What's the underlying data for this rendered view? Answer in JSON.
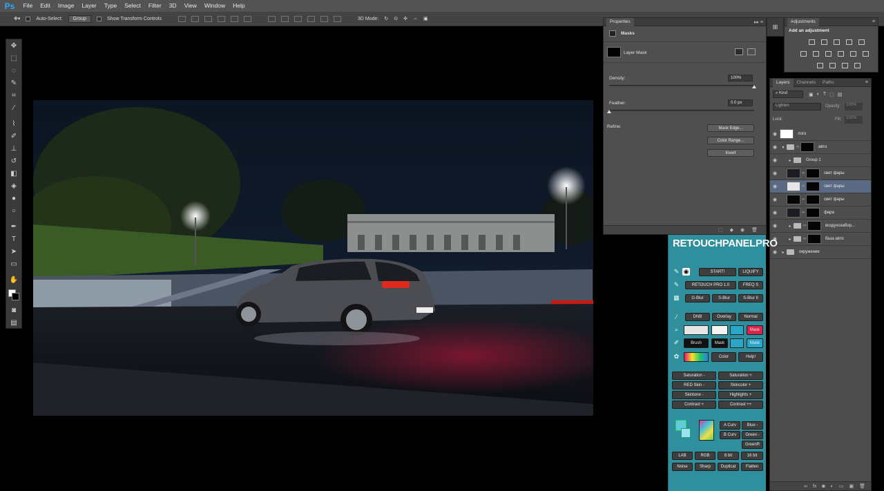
{
  "app": {
    "logo": "Ps"
  },
  "menu": [
    "File",
    "Edit",
    "Image",
    "Layer",
    "Type",
    "Select",
    "Filter",
    "3D",
    "View",
    "Window",
    "Help"
  ],
  "options_bar": {
    "auto_select_label": "Auto-Select:",
    "auto_select_value": "Group",
    "show_transform_label": "Show Transform Controls",
    "mode_3d_label": "3D Mode:"
  },
  "properties": {
    "tab": "Properties",
    "section": "Masks",
    "mask_type": "Layer Mask",
    "density_label": "Density:",
    "density_value": "100%",
    "density_fraction": 1.0,
    "feather_label": "Feather:",
    "feather_value": "0.0 px",
    "feather_fraction": 0.0,
    "refine_label": "Refine:",
    "buttons": [
      "Mask Edge...",
      "Color Range...",
      "Invert"
    ]
  },
  "adjustments": {
    "tab": "Adjustments",
    "title": "Add an adjustment"
  },
  "layers_panel": {
    "tabs": [
      "Layers",
      "Channels",
      "Paths"
    ],
    "filter_kind": "Kind",
    "blend_mode": "Lighten",
    "opacity_label": "Opacity:",
    "opacity_value": "100%",
    "lock_label": "Lock:",
    "fill_label": "Fill:",
    "fill_value": "100%",
    "layers": [
      {
        "name": "лого",
        "thumb": "white",
        "has_mask": false,
        "indent": 0,
        "type": "layer"
      },
      {
        "name": "авто",
        "thumb": "folder",
        "has_mask": true,
        "indent": 0,
        "type": "group-open"
      },
      {
        "name": "Group 1",
        "thumb": "folder",
        "has_mask": false,
        "indent": 1,
        "type": "group"
      },
      {
        "name": "свет фары",
        "thumb": "photo",
        "has_mask": true,
        "indent": 1,
        "type": "layer"
      },
      {
        "name": "свет фары",
        "thumb": "check",
        "has_mask": true,
        "indent": 1,
        "type": "layer",
        "selected": true
      },
      {
        "name": "свет фары",
        "thumb": "black",
        "has_mask": true,
        "indent": 1,
        "type": "layer"
      },
      {
        "name": "фара",
        "thumb": "photo",
        "has_mask": true,
        "indent": 1,
        "type": "layer"
      },
      {
        "name": "воздухозабор...",
        "thumb": "folder",
        "has_mask": true,
        "indent": 1,
        "type": "group"
      },
      {
        "name": "база авто",
        "thumb": "folder",
        "has_mask": true,
        "indent": 1,
        "type": "group"
      },
      {
        "name": "окружение",
        "thumb": "folder",
        "has_mask": false,
        "indent": 0,
        "type": "group"
      }
    ]
  },
  "retouch_panel": {
    "title_a": "RETOUCHPANEL",
    "title_b": "PRO",
    "row1": [
      "START!",
      "LIQUIFY"
    ],
    "row2": [
      "RETOUCH PRO 1.0",
      "FREQ S"
    ],
    "row3": [
      "G-Blur",
      "S-Blur",
      "S-Blur II"
    ],
    "row4": [
      "DNB",
      "Overlay",
      "Normal"
    ],
    "mask_label": "Mask",
    "brush_label": "Brush",
    "color_label": "Color",
    "help_label": "Help!",
    "adjust": [
      "Saturation -",
      "Saturation +",
      "RED Skin -",
      "Skincolor +",
      "Skintone -",
      "Highlights +",
      "Contrast +",
      "Contrast ++"
    ],
    "curves": [
      "A Curv",
      "Blue -",
      "B Curv",
      "Green -",
      "GreenR"
    ],
    "bottom1": [
      "LAB",
      "RGB",
      "8 bit",
      "16 bit"
    ],
    "bottom2": [
      "Noise",
      "Sharp",
      "Duplicat",
      "Flatten"
    ]
  },
  "colors": {
    "accent": "#31a8ff",
    "panel_teal": "#2f8f9c",
    "selected_layer": "#5a6a84"
  }
}
